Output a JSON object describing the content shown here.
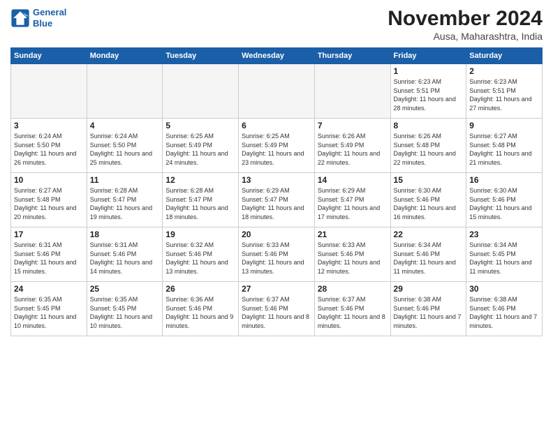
{
  "header": {
    "logo_line1": "General",
    "logo_line2": "Blue",
    "month": "November 2024",
    "location": "Ausa, Maharashtra, India"
  },
  "weekdays": [
    "Sunday",
    "Monday",
    "Tuesday",
    "Wednesday",
    "Thursday",
    "Friday",
    "Saturday"
  ],
  "weeks": [
    [
      {
        "day": "",
        "info": "",
        "empty": true
      },
      {
        "day": "",
        "info": "",
        "empty": true
      },
      {
        "day": "",
        "info": "",
        "empty": true
      },
      {
        "day": "",
        "info": "",
        "empty": true
      },
      {
        "day": "",
        "info": "",
        "empty": true
      },
      {
        "day": "1",
        "info": "Sunrise: 6:23 AM\nSunset: 5:51 PM\nDaylight: 11 hours\nand 28 minutes."
      },
      {
        "day": "2",
        "info": "Sunrise: 6:23 AM\nSunset: 5:51 PM\nDaylight: 11 hours\nand 27 minutes."
      }
    ],
    [
      {
        "day": "3",
        "info": "Sunrise: 6:24 AM\nSunset: 5:50 PM\nDaylight: 11 hours\nand 26 minutes."
      },
      {
        "day": "4",
        "info": "Sunrise: 6:24 AM\nSunset: 5:50 PM\nDaylight: 11 hours\nand 25 minutes."
      },
      {
        "day": "5",
        "info": "Sunrise: 6:25 AM\nSunset: 5:49 PM\nDaylight: 11 hours\nand 24 minutes."
      },
      {
        "day": "6",
        "info": "Sunrise: 6:25 AM\nSunset: 5:49 PM\nDaylight: 11 hours\nand 23 minutes."
      },
      {
        "day": "7",
        "info": "Sunrise: 6:26 AM\nSunset: 5:49 PM\nDaylight: 11 hours\nand 22 minutes."
      },
      {
        "day": "8",
        "info": "Sunrise: 6:26 AM\nSunset: 5:48 PM\nDaylight: 11 hours\nand 22 minutes."
      },
      {
        "day": "9",
        "info": "Sunrise: 6:27 AM\nSunset: 5:48 PM\nDaylight: 11 hours\nand 21 minutes."
      }
    ],
    [
      {
        "day": "10",
        "info": "Sunrise: 6:27 AM\nSunset: 5:48 PM\nDaylight: 11 hours\nand 20 minutes."
      },
      {
        "day": "11",
        "info": "Sunrise: 6:28 AM\nSunset: 5:47 PM\nDaylight: 11 hours\nand 19 minutes."
      },
      {
        "day": "12",
        "info": "Sunrise: 6:28 AM\nSunset: 5:47 PM\nDaylight: 11 hours\nand 18 minutes."
      },
      {
        "day": "13",
        "info": "Sunrise: 6:29 AM\nSunset: 5:47 PM\nDaylight: 11 hours\nand 18 minutes."
      },
      {
        "day": "14",
        "info": "Sunrise: 6:29 AM\nSunset: 5:47 PM\nDaylight: 11 hours\nand 17 minutes."
      },
      {
        "day": "15",
        "info": "Sunrise: 6:30 AM\nSunset: 5:46 PM\nDaylight: 11 hours\nand 16 minutes."
      },
      {
        "day": "16",
        "info": "Sunrise: 6:30 AM\nSunset: 5:46 PM\nDaylight: 11 hours\nand 15 minutes."
      }
    ],
    [
      {
        "day": "17",
        "info": "Sunrise: 6:31 AM\nSunset: 5:46 PM\nDaylight: 11 hours\nand 15 minutes."
      },
      {
        "day": "18",
        "info": "Sunrise: 6:31 AM\nSunset: 5:46 PM\nDaylight: 11 hours\nand 14 minutes."
      },
      {
        "day": "19",
        "info": "Sunrise: 6:32 AM\nSunset: 5:46 PM\nDaylight: 11 hours\nand 13 minutes."
      },
      {
        "day": "20",
        "info": "Sunrise: 6:33 AM\nSunset: 5:46 PM\nDaylight: 11 hours\nand 13 minutes."
      },
      {
        "day": "21",
        "info": "Sunrise: 6:33 AM\nSunset: 5:46 PM\nDaylight: 11 hours\nand 12 minutes."
      },
      {
        "day": "22",
        "info": "Sunrise: 6:34 AM\nSunset: 5:46 PM\nDaylight: 11 hours\nand 11 minutes."
      },
      {
        "day": "23",
        "info": "Sunrise: 6:34 AM\nSunset: 5:45 PM\nDaylight: 11 hours\nand 11 minutes."
      }
    ],
    [
      {
        "day": "24",
        "info": "Sunrise: 6:35 AM\nSunset: 5:45 PM\nDaylight: 11 hours\nand 10 minutes."
      },
      {
        "day": "25",
        "info": "Sunrise: 6:35 AM\nSunset: 5:45 PM\nDaylight: 11 hours\nand 10 minutes."
      },
      {
        "day": "26",
        "info": "Sunrise: 6:36 AM\nSunset: 5:46 PM\nDaylight: 11 hours\nand 9 minutes."
      },
      {
        "day": "27",
        "info": "Sunrise: 6:37 AM\nSunset: 5:46 PM\nDaylight: 11 hours\nand 8 minutes."
      },
      {
        "day": "28",
        "info": "Sunrise: 6:37 AM\nSunset: 5:46 PM\nDaylight: 11 hours\nand 8 minutes."
      },
      {
        "day": "29",
        "info": "Sunrise: 6:38 AM\nSunset: 5:46 PM\nDaylight: 11 hours\nand 7 minutes."
      },
      {
        "day": "30",
        "info": "Sunrise: 6:38 AM\nSunset: 5:46 PM\nDaylight: 11 hours\nand 7 minutes."
      }
    ]
  ]
}
